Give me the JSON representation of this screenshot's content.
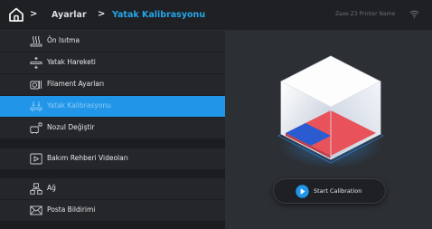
{
  "header": {
    "breadcrumb_root": "Ayarlar",
    "breadcrumb_current": "Yatak Kalibrasyonu",
    "separator": ">",
    "printer_name": "Zaxe Z3 Printer Name"
  },
  "sidebar": {
    "items": [
      {
        "label": "Ön Isıtma",
        "icon": "preheat-icon",
        "active": false
      },
      {
        "label": "Yatak Hareketi",
        "icon": "bed-move-icon",
        "active": false
      },
      {
        "label": "Filament Ayarları",
        "icon": "filament-icon",
        "active": false
      },
      {
        "label": "Yatak Kalibrasyonu",
        "icon": "bed-calibration-icon",
        "active": true
      },
      {
        "label": "Nozul Değiştir",
        "icon": "nozzle-change-icon",
        "active": false
      },
      {
        "label": "Bakım Rehberi Videoları",
        "icon": "video-play-icon",
        "active": false
      },
      {
        "label": "Ağ",
        "icon": "network-icon",
        "active": false
      },
      {
        "label": "Posta Bildirimi",
        "icon": "mail-icon",
        "active": false
      }
    ]
  },
  "main": {
    "start_button_label": "Start Calibration",
    "illustration": "cube-calibration-icon"
  },
  "colors": {
    "accent": "#2196e9",
    "current_crumb": "#26a6ea",
    "cube_red": "#e8525a",
    "cube_blue": "#2a5bd0"
  }
}
